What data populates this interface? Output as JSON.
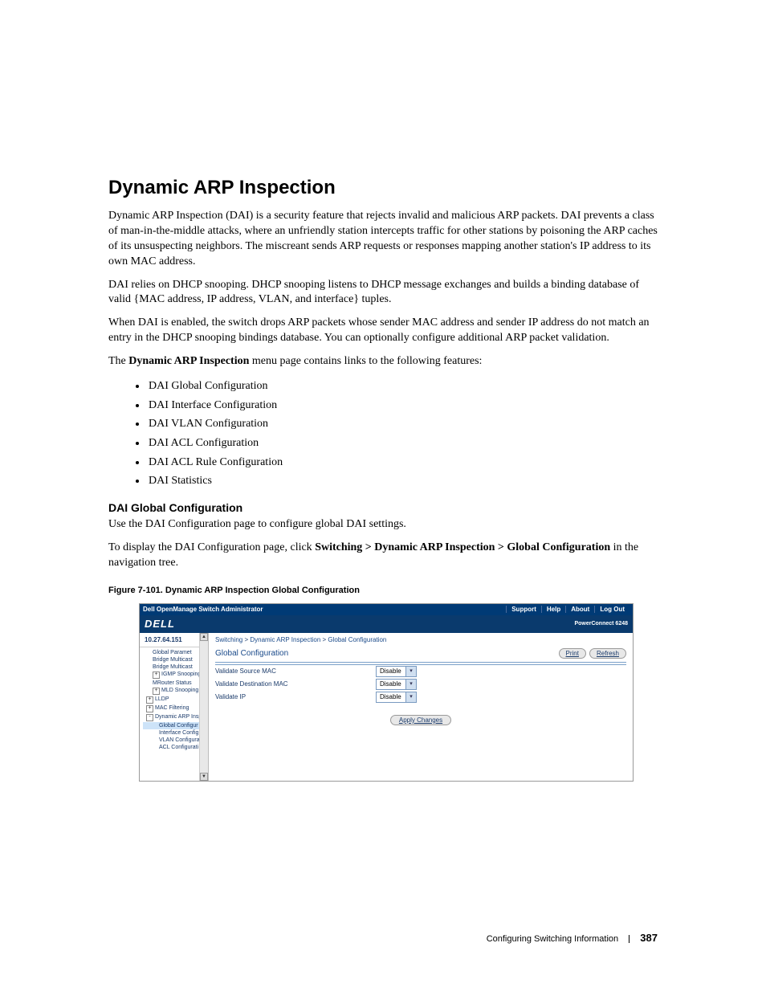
{
  "h1": "Dynamic ARP Inspection",
  "p1": "Dynamic ARP Inspection (DAI) is a security feature that rejects invalid and malicious ARP packets. DAI prevents a class of man-in-the-middle attacks, where an unfriendly station intercepts traffic for other stations by poisoning the ARP caches of its unsuspecting neighbors. The miscreant sends ARP requests or responses mapping another station's IP address to its own MAC address.",
  "p2": "DAI relies on DHCP snooping. DHCP snooping listens to DHCP message exchanges and builds a binding database of valid {MAC address, IP address, VLAN, and interface} tuples.",
  "p3": "When DAI is enabled, the switch drops ARP packets whose sender MAC address and sender IP address do not match an entry in the DHCP snooping bindings database. You can optionally configure additional ARP packet validation.",
  "p4_a": "The ",
  "p4_b": "Dynamic ARP Inspection",
  "p4_c": " menu page contains links to the following features:",
  "features": [
    "DAI Global Configuration",
    "DAI Interface Configuration",
    "DAI VLAN Configuration",
    "DAI ACL Configuration",
    "DAI ACL Rule Configuration",
    "DAI Statistics"
  ],
  "h2": "DAI Global Configuration",
  "p5": "Use the DAI Configuration page to configure global DAI settings.",
  "p6_a": "To display the DAI Configuration page, click ",
  "p6_b": "Switching > Dynamic ARP Inspection > Global Configuration",
  "p6_c": " in the navigation tree.",
  "fig_caption": "Figure 7-101.   Dynamic ARP Inspection Global Configuration",
  "screenshot": {
    "titlebar_title": "Dell OpenManage Switch Administrator",
    "titlebar_links": [
      "Support",
      "Help",
      "About",
      "Log Out"
    ],
    "logo": "DELL",
    "product": "PowerConnect 6248",
    "ip": "10.27.64.151",
    "tree": [
      {
        "label": "Global Paramet",
        "lvl": 2,
        "exp": ""
      },
      {
        "label": "Bridge Multicast",
        "lvl": 2,
        "exp": ""
      },
      {
        "label": "Bridge Multicast",
        "lvl": 2,
        "exp": ""
      },
      {
        "label": "IGMP Snooping",
        "lvl": 2,
        "exp": "+"
      },
      {
        "label": "MRouter Status",
        "lvl": 2,
        "exp": ""
      },
      {
        "label": "MLD Snooping",
        "lvl": 2,
        "exp": "+"
      },
      {
        "label": "LLDP",
        "lvl": 1,
        "exp": "+"
      },
      {
        "label": "MAC Filtering",
        "lvl": 1,
        "exp": "+"
      },
      {
        "label": "Dynamic ARP Insp",
        "lvl": 1,
        "exp": "-"
      },
      {
        "label": "Global Configur",
        "lvl": 3,
        "exp": "",
        "selected": true
      },
      {
        "label": "Interface Config",
        "lvl": 3,
        "exp": ""
      },
      {
        "label": "VLAN Configura",
        "lvl": 3,
        "exp": ""
      },
      {
        "label": "ACL Configurati",
        "lvl": 3,
        "exp": ""
      }
    ],
    "breadcrumb": {
      "a": "Switching",
      "b": "Dynamic ARP Inspection",
      "c": "Global Configuration"
    },
    "panel_title": "Global Configuration",
    "print": "Print",
    "refresh": "Refresh",
    "rows": [
      {
        "label": "Validate Source MAC",
        "value": "Disable"
      },
      {
        "label": "Validate Destination MAC",
        "value": "Disable"
      },
      {
        "label": "Validate IP",
        "value": "Disable"
      }
    ],
    "apply": "Apply Changes"
  },
  "footer_text": "Configuring Switching Information",
  "page_num": "387"
}
